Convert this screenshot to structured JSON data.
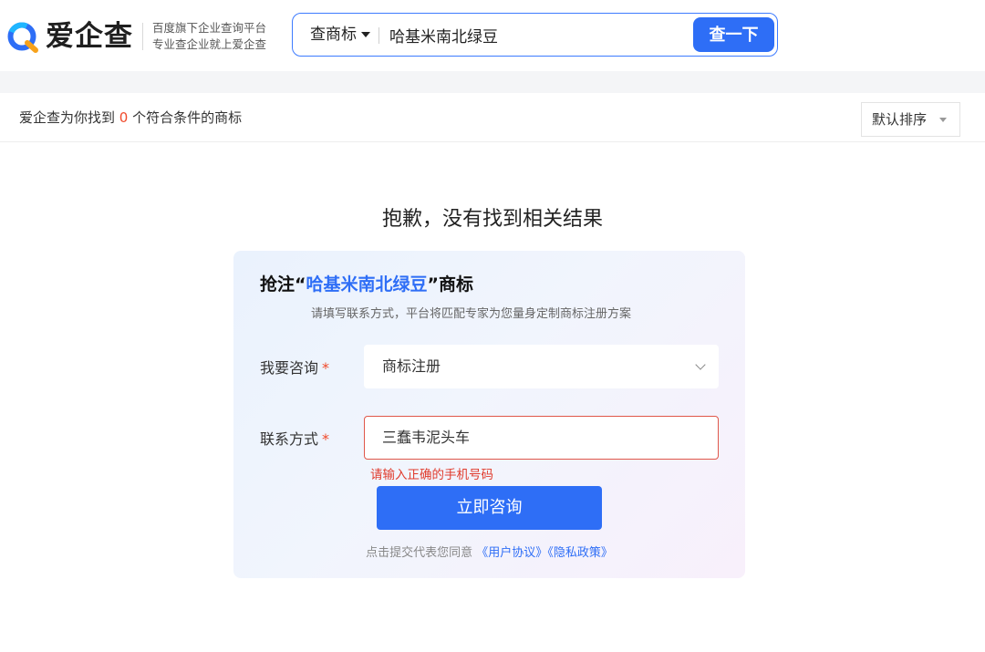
{
  "header": {
    "logo_text": "爱企查",
    "slogan_line1": "百度旗下企业查询平台",
    "slogan_line2": "专业查企业就上爱企查",
    "search": {
      "type_label": "查商标",
      "query": "哈基米南北绿豆",
      "button_label": "查一下"
    }
  },
  "results": {
    "prefix": "爱企查为你找到 ",
    "count": "0",
    "suffix": " 个符合条件的商标",
    "sort_label": "默认排序"
  },
  "empty_state": {
    "title": "抱歉，没有找到相关结果"
  },
  "consult_card": {
    "title_prefix": "抢注“",
    "title_keyword": "哈基米南北绿豆",
    "title_suffix": "”商标",
    "subtitle": "请填写联系方式，平台将匹配专家为您量身定制商标注册方案",
    "consult_label": "我要咨询",
    "consult_value": "商标注册",
    "contact_label": "联系方式",
    "contact_value": "三蠢韦泥头车",
    "required_mark": "*",
    "error_message": "请输入正确的手机号码",
    "submit_label": "立即咨询",
    "agree_text": "点击提交代表您同意 ",
    "user_agreement": "《用户协议》",
    "privacy_policy": "《隐私政策》"
  },
  "colors": {
    "brand_blue": "#2e6ef6",
    "error_red": "#e03a2b",
    "count_orange": "#f04a2b"
  }
}
